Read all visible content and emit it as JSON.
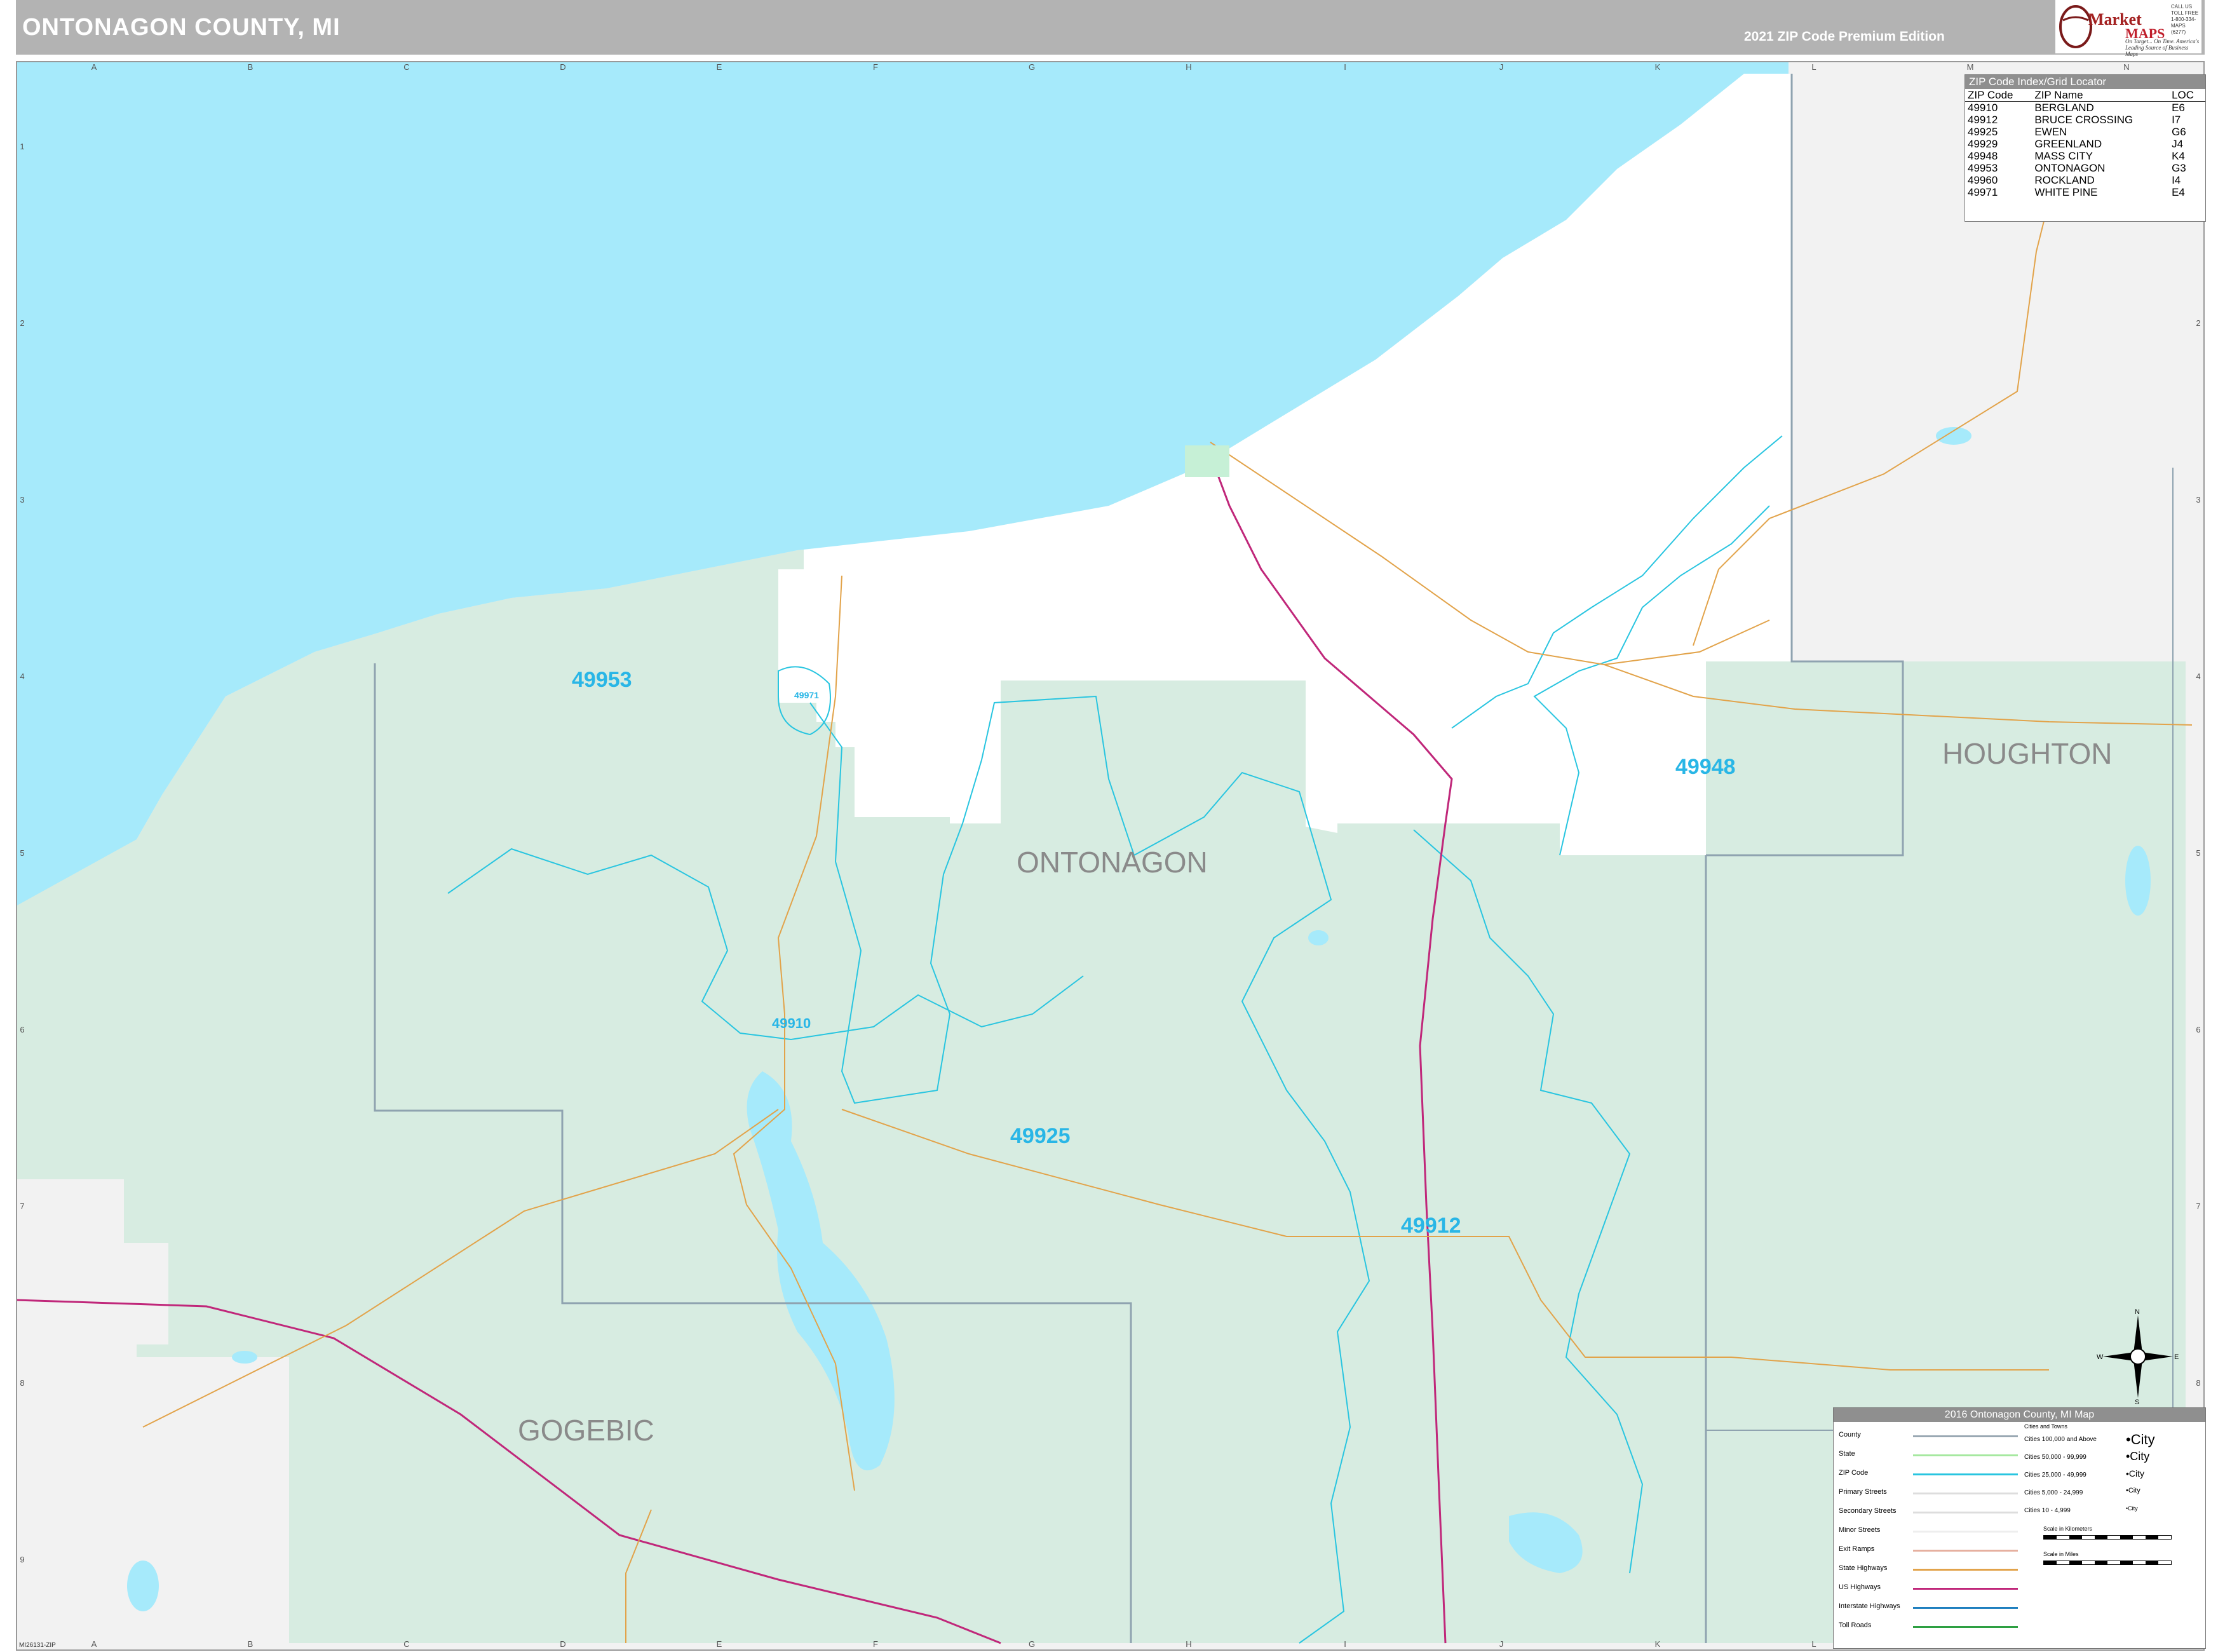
{
  "header": {
    "title": "ONTONAGON COUNTY, MI",
    "edition": "2021 ZIP Code Premium Edition",
    "brand_name": "Market",
    "brand_maps": "MAPS",
    "brand_tagline": "On Target... On Time. America's Leading Source of Business Maps",
    "brand_contact": "CALL US TOLL FREE 1-800-334-MAPS (6277)"
  },
  "colors": {
    "water": "#a6eafb",
    "zip_area": "#d7ece1",
    "ontonagon_zip_area": "#ffffff",
    "outside_area": "#f2f2f2",
    "zip_boundary": "#29c5e0",
    "county_boundary": "#8fa3b0",
    "us_highway": "#c0277a",
    "state_highway": "#e2a34a",
    "zip_label": "#29b6e6",
    "county_label": "#8a8a8a"
  },
  "grid": {
    "columns": [
      "A",
      "B",
      "C",
      "D",
      "E",
      "F",
      "G",
      "H",
      "I",
      "J",
      "K",
      "L",
      "M",
      "N"
    ],
    "rows": [
      "1",
      "2",
      "3",
      "4",
      "5",
      "6",
      "7",
      "8",
      "9"
    ]
  },
  "map": {
    "zip_labels": [
      {
        "zip": "49953"
      },
      {
        "zip": "49948"
      },
      {
        "zip": "49910"
      },
      {
        "zip": "49925"
      },
      {
        "zip": "49912"
      },
      {
        "zip": "49971"
      }
    ],
    "county_labels": [
      "ONTONAGON",
      "HOUGHTON",
      "GOGEBIC"
    ]
  },
  "zip_index": {
    "title": "ZIP Code Index/Grid Locator",
    "columns": [
      "ZIP Code",
      "ZIP Name",
      "LOC"
    ],
    "rows": [
      [
        "49910",
        "BERGLAND",
        "E6"
      ],
      [
        "49912",
        "BRUCE CROSSING",
        "I7"
      ],
      [
        "49925",
        "EWEN",
        "G6"
      ],
      [
        "49929",
        "GREENLAND",
        "J4"
      ],
      [
        "49948",
        "MASS CITY",
        "K4"
      ],
      [
        "49953",
        "ONTONAGON",
        "G3"
      ],
      [
        "49960",
        "ROCKLAND",
        "I4"
      ],
      [
        "49971",
        "WHITE PINE",
        "E4"
      ]
    ]
  },
  "legend": {
    "title": "2016 Ontonagon County, MI Map",
    "line_items": [
      "County",
      "State",
      "ZIP Code",
      "Primary Streets",
      "Secondary Streets",
      "Minor Streets",
      "Exit Ramps",
      "State Highways",
      "US Highways",
      "Interstate Highways",
      "Toll Roads"
    ],
    "cities_header": "Cities and Towns",
    "city_classes": [
      "Cities 100,000 and Above",
      "Cities 50,000 - 99,999",
      "Cities 25,000 - 49,999",
      "Cities 5,000 - 24,999",
      "Cities 10 - 4,999"
    ],
    "city_samples": [
      "•City",
      "•City",
      "•City",
      "•City",
      "•City"
    ],
    "scale_km": "Scale in Kilometers",
    "scale_mi": "Scale in Miles"
  },
  "compass": {
    "n": "N",
    "s": "S",
    "e": "E",
    "w": "W"
  },
  "footer": {
    "code": "MI26131-ZIP"
  }
}
